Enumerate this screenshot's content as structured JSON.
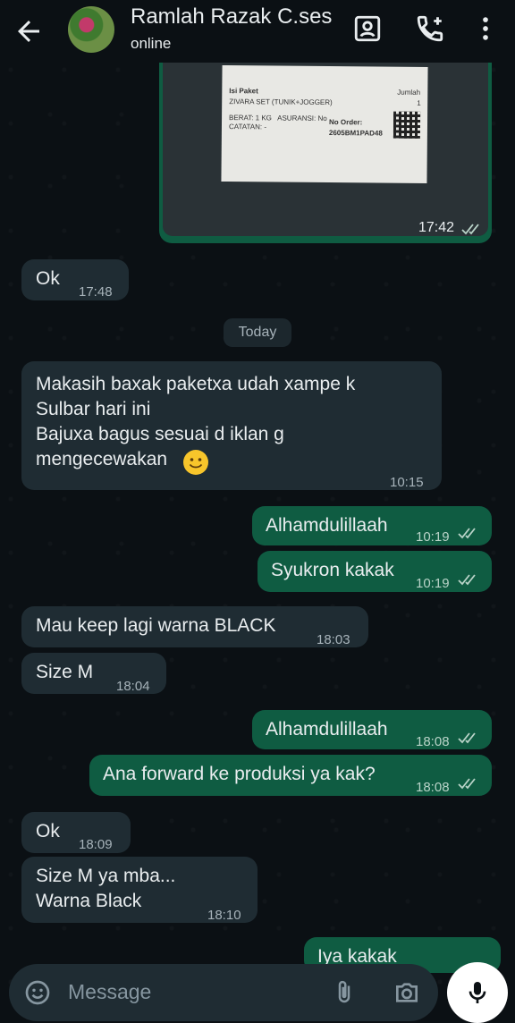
{
  "header": {
    "contact_name": "Ramlah Razak C.ses",
    "status": "online"
  },
  "image_message": {
    "label_lines": {
      "l1": "Isi Paket",
      "l2": "ZIVARA SET (TUNIK+JOGGER)",
      "l3": "BERAT: 1 KG   ASURANSI: No",
      "l4": "CATATAN: -",
      "jumlah": "Jumlah",
      "qty": "1",
      "order_label": "No Order:",
      "order_no": "2605BM1PAD48"
    },
    "time": "17:42"
  },
  "messages": [
    {
      "text": "Ok",
      "time": "17:48"
    },
    {
      "text": "Today"
    },
    {
      "text": "Makasih baxak paketxa udah xampe k\nSulbar hari ini\nBajuxa bagus sesuai d iklan g\nmengecewakan",
      "emoji": "smiling-face",
      "time": "10:15"
    },
    {
      "text": "Alhamdulillaah",
      "time": "10:19"
    },
    {
      "text": "Syukron kakak",
      "time": "10:19"
    },
    {
      "text": "Mau keep lagi warna BLACK",
      "time": "18:03"
    },
    {
      "text": "Size M",
      "time": "18:04"
    },
    {
      "text": "Alhamdulillaah",
      "time": "18:08"
    },
    {
      "text": "Ana forward ke produksi ya kak?",
      "time": "18:08"
    },
    {
      "text": "Ok",
      "time": "18:09"
    },
    {
      "text": "Size M ya mba...\nWarna Black",
      "time": "18:10"
    },
    {
      "text": "Iya kakak"
    }
  ],
  "input": {
    "placeholder": "Message"
  },
  "colors": {
    "incoming": "#1f2c33",
    "outgoing": "#0f5c42",
    "background": "#0b1014",
    "tick_read": "#b9d3c8"
  }
}
